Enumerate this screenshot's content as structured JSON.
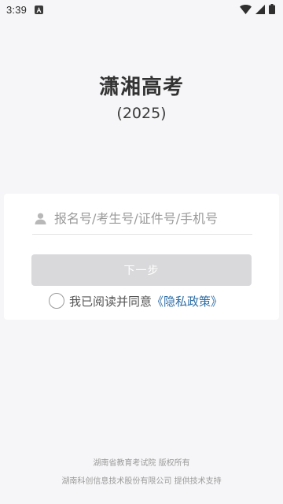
{
  "status_bar": {
    "time": "3:39",
    "icons": [
      "notification-a-icon",
      "wifi-icon",
      "cellular-signal-icon",
      "battery-icon"
    ]
  },
  "header": {
    "title": "潇湘高考",
    "subtitle": "(2025)"
  },
  "login": {
    "input_placeholder": "报名号/考生号/证件号/手机号",
    "input_value": "",
    "next_button_label": "下一步",
    "agreement_checked": false,
    "agreement_text": "我已阅读并同意",
    "privacy_link_text": "《隐私政策》"
  },
  "footer": {
    "line1": "湖南省教育考试院 版权所有",
    "line2": "湖南科创信息技术股份有限公司 提供技术支持"
  },
  "colors": {
    "background": "#f6f6f8",
    "card": "#ffffff",
    "button_disabled": "#d9d9db",
    "link": "#2f6ea6"
  }
}
